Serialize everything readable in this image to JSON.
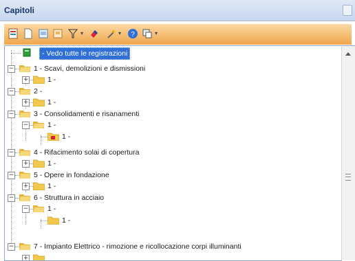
{
  "panel": {
    "title": "Capitoli"
  },
  "toolbar": {
    "buttons": [
      "new-chapter-icon",
      "new-document-icon",
      "edit-icon",
      "print-icon",
      "filter-icon",
      "eraser-icon",
      "wand-icon",
      "help-icon",
      "properties-icon"
    ]
  },
  "tree": {
    "root_label": "- Vedo tutte le registrazioni",
    "chapters": [
      {
        "label": "1 - Scavi, demolizioni e dismissioni",
        "child": "1 -"
      },
      {
        "label": "2 -",
        "child": "1 -"
      },
      {
        "label": "3 - Consolidamenti e risanamenti",
        "child": "1 -",
        "grandchild": "1 -"
      },
      {
        "label": "4 - Rifacimento solai di copertura",
        "child": "1 -"
      },
      {
        "label": "5 - Opere in fondazione",
        "child": "1 -"
      },
      {
        "label": "6 - Struttura in acciaio",
        "child": "1 -",
        "grandchild": "1 -"
      },
      {
        "label": "7 - Impianto Elettrico - rimozione e ricollocazione corpi illuminanti"
      }
    ]
  },
  "colors": {
    "toolbar_bg": "#f7c27a",
    "title_bg": "#c6d7ee",
    "selection": "#2f6fd6",
    "folder": "#f2c94c"
  }
}
